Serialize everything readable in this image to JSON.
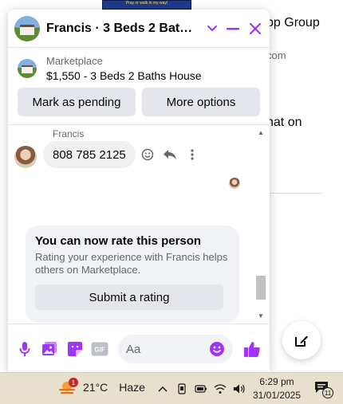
{
  "background": {
    "banner_text": "Pray or walk in my way!",
    "line1": "pp Group",
    "line2": "com",
    "line3": "hat on"
  },
  "chat": {
    "title": "Francis · 3 Beds 2 Baths H...",
    "accent": "#a033ff",
    "listing": {
      "source": "Marketplace",
      "name": "$1,550 - 3 Beds 2 Baths House",
      "mark_pending_label": "Mark as pending",
      "more_options_label": "More options"
    },
    "message": {
      "sender": "Francis",
      "text": "808 785 2125"
    },
    "rating": {
      "title": "You can now rate this person",
      "body": "Rating your experience with Francis helps others on Marketplace.",
      "button_label": "Submit a rating"
    },
    "composer": {
      "placeholder": "Aa",
      "icons": [
        "microphone-icon",
        "photo-icon",
        "sticker-icon",
        "gif-icon",
        "emoji-icon",
        "like-icon"
      ],
      "gif_label": "GIF"
    }
  },
  "taskbar": {
    "weather_badge": "1",
    "temperature": "21°C",
    "condition": "Haze",
    "time": "6:29 pm",
    "date": "31/01/2025",
    "notification_count": "11"
  }
}
